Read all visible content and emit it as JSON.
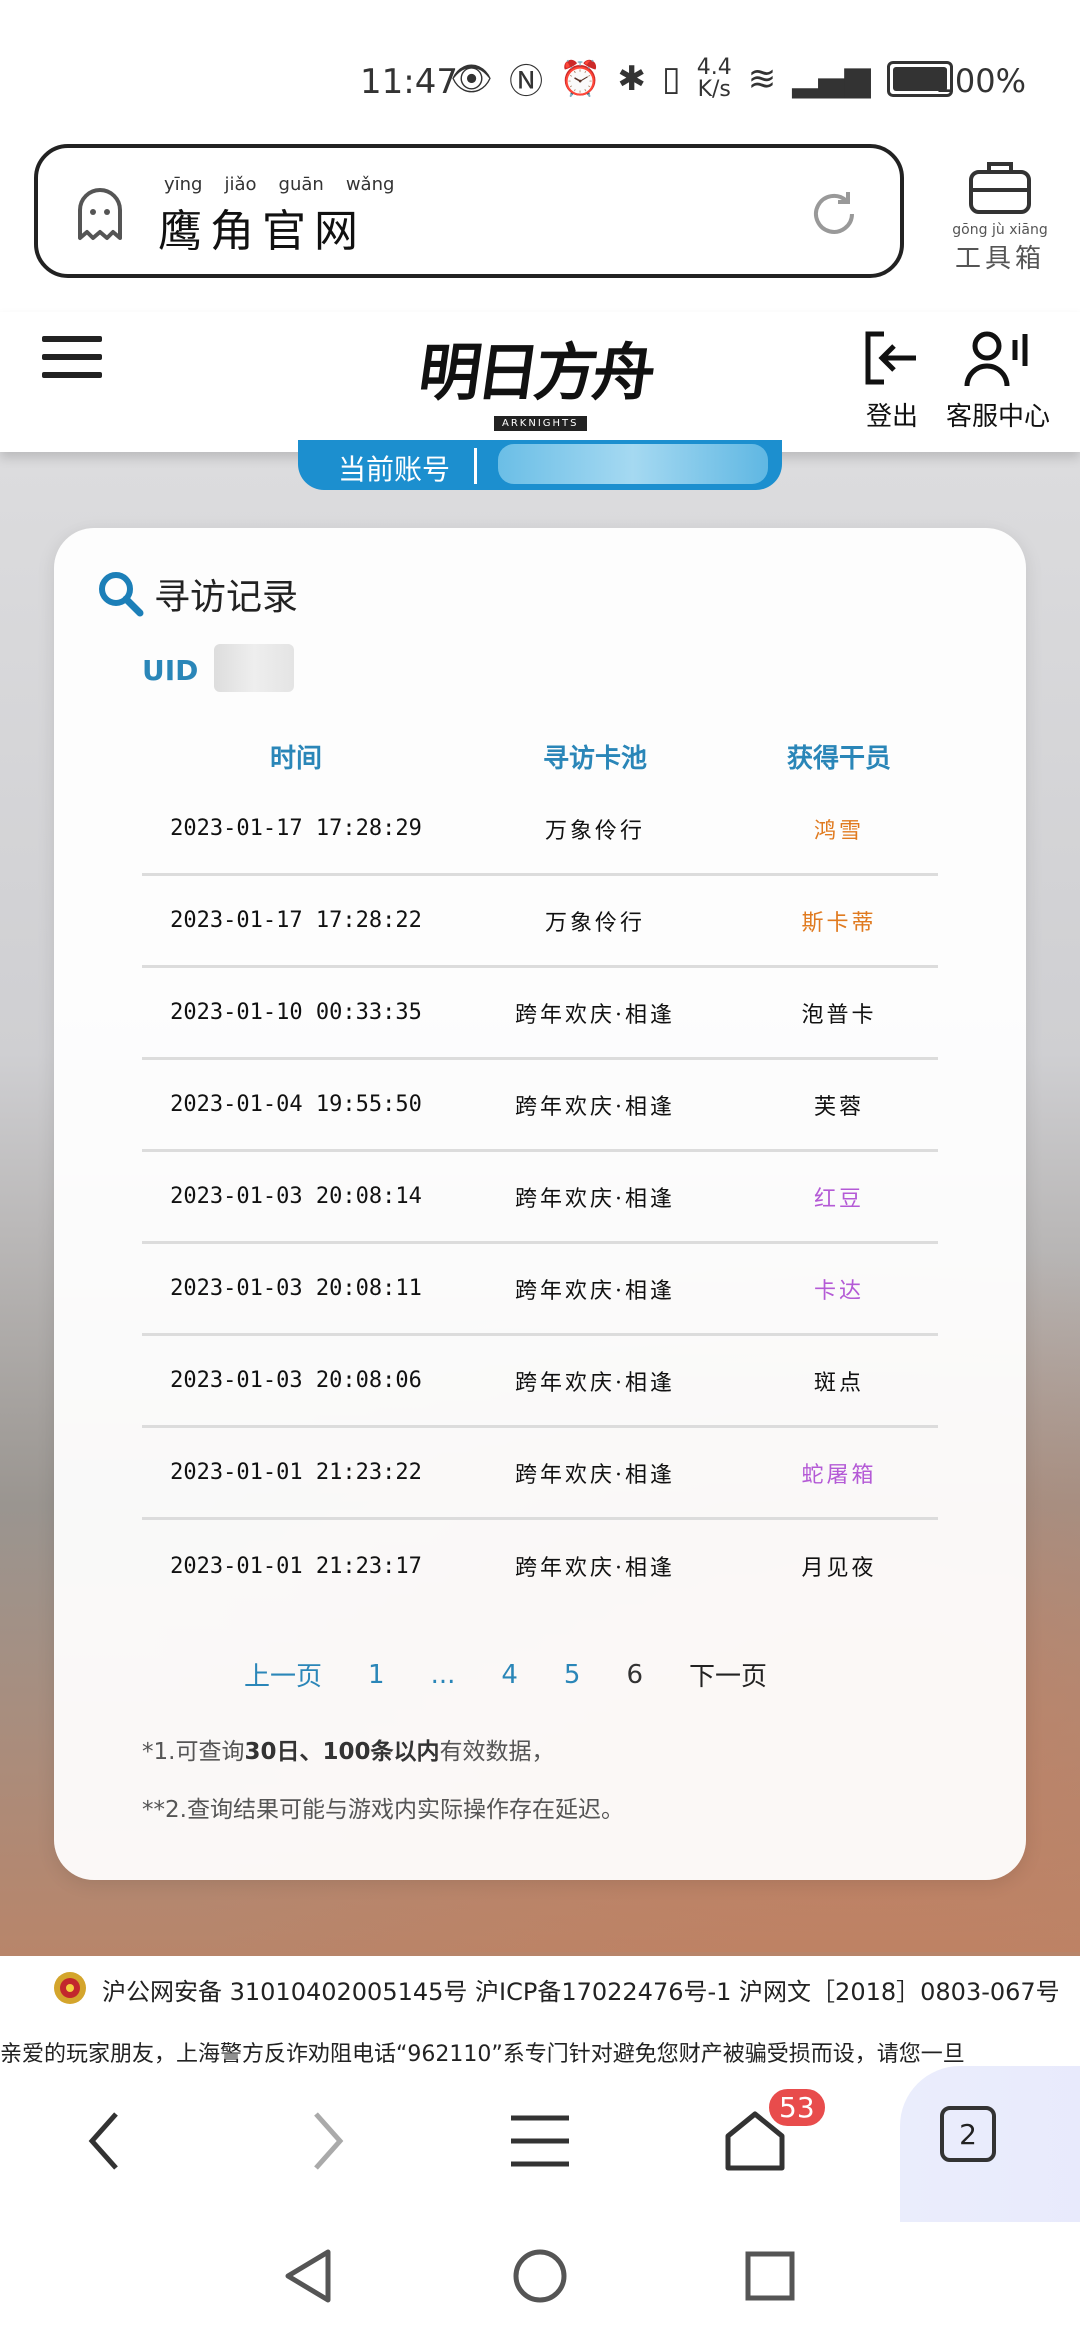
{
  "status_bar": {
    "time": "11:47",
    "net_speed_top": "4.4",
    "net_speed_bottom": "K/s",
    "battery_pct": "100%"
  },
  "address_bar": {
    "site_name": "鹰角官网",
    "pinyin": [
      "yīng",
      "jiǎo",
      "guān",
      "wǎng"
    ]
  },
  "toolbox": {
    "label": "工具箱",
    "pinyin": [
      "gōng",
      "jù",
      "xiāng"
    ]
  },
  "site_header": {
    "logo": "明日方舟",
    "logo_sub": "ARKNIGHTS",
    "logout_label": "登出",
    "service_label": "客服中心"
  },
  "account": {
    "label": "当前账号"
  },
  "card": {
    "title": "寻访记录",
    "uid_label": "UID"
  },
  "table": {
    "headers": [
      "时间",
      "寻访卡池",
      "获得干员"
    ],
    "rows": [
      {
        "time": "2023-01-17 17:28:29",
        "pool": "万象伶行",
        "operator": "鸿雪",
        "color": "#e07a1f"
      },
      {
        "time": "2023-01-17 17:28:22",
        "pool": "万象伶行",
        "operator": "斯卡蒂",
        "color": "#e07a1f"
      },
      {
        "time": "2023-01-10 00:33:35",
        "pool": "跨年欢庆·相逢",
        "operator": "泡普卡",
        "color": "#111111"
      },
      {
        "time": "2023-01-04 19:55:50",
        "pool": "跨年欢庆·相逢",
        "operator": "芙蓉",
        "color": "#111111"
      },
      {
        "time": "2023-01-03 20:08:14",
        "pool": "跨年欢庆·相逢",
        "operator": "红豆",
        "color": "#b45ad6"
      },
      {
        "time": "2023-01-03 20:08:11",
        "pool": "跨年欢庆·相逢",
        "operator": "卡达",
        "color": "#b45ad6"
      },
      {
        "time": "2023-01-03 20:08:06",
        "pool": "跨年欢庆·相逢",
        "operator": "斑点",
        "color": "#111111"
      },
      {
        "time": "2023-01-01 21:23:22",
        "pool": "跨年欢庆·相逢",
        "operator": "蛇屠箱",
        "color": "#b45ad6"
      },
      {
        "time": "2023-01-01 21:23:17",
        "pool": "跨年欢庆·相逢",
        "operator": "月见夜",
        "color": "#111111"
      }
    ]
  },
  "pagination": {
    "prev": "上一页",
    "pages": [
      "1",
      "...",
      "4",
      "5",
      "6"
    ],
    "current": "6",
    "next": "下一页"
  },
  "notes": {
    "note1_prefix": "*1.可查询",
    "note1_bold1": "30日、100条以内",
    "note1_suffix": "有效数据，",
    "note2": "**2.查询结果可能与游戏内实际操作存在延迟。"
  },
  "footer": {
    "registration": "沪公网安备 31010402005145号  沪ICP备17022476号-1  沪网文［2018］0803-067号",
    "ticker": "亲爱的玩家朋友，上海警方反诈劝阻电话“962110”系专门针对避免您财产被骗受损而设，请您一旦"
  },
  "browser_bar": {
    "home_badge": "53",
    "tab_count": "2"
  },
  "colors": {
    "accent": "#2a86b8",
    "account_bg": "#1c8fcf",
    "six_star": "#e07a1f",
    "four_star": "#b45ad6",
    "badge": "#e84c4c"
  }
}
